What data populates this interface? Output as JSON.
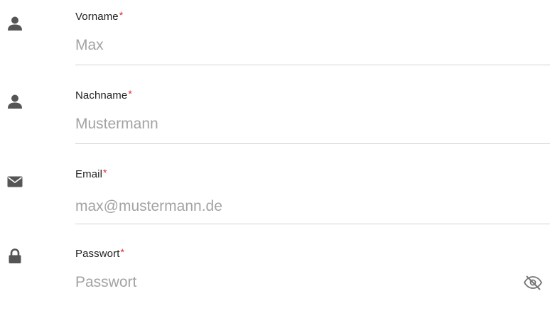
{
  "form": {
    "fields": [
      {
        "label": "Vorname",
        "required_mark": "*",
        "placeholder": "Max",
        "icon": "user-icon"
      },
      {
        "label": "Nachname",
        "required_mark": "*",
        "placeholder": "Mustermann",
        "icon": "user-icon"
      },
      {
        "label": "Email",
        "required_mark": "*",
        "placeholder": "max@mustermann.de",
        "icon": "envelope-icon"
      },
      {
        "label": "Passwort",
        "required_mark": "*",
        "placeholder": "Passwort",
        "icon": "lock-icon",
        "toggle_icon": "eye-slash-icon"
      }
    ]
  },
  "colors": {
    "icon": "#555555",
    "label": "#222222",
    "required": "#e0282e",
    "placeholder": "#a3a3a3",
    "underline": "#d4d4d4"
  }
}
